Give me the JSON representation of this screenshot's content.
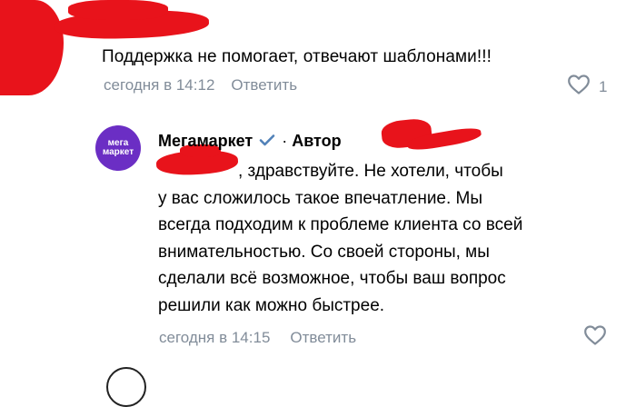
{
  "comment1": {
    "text": "Поддержка не помогает, отвечают шаблонами!!!",
    "time": "сегодня в 14:12",
    "reply_label": "Ответить",
    "like_count": "1"
  },
  "comment2": {
    "author": "Мегамаркет",
    "author_badge": "Автор",
    "avatar_text_1": "мега",
    "avatar_text_2": "маркет",
    "lines": [
      ", здравствуйте. Не хотели, чтобы",
      "у вас сложилось такое впечатление. Мы",
      "всегда подходим к проблеме клиента со всей",
      "внимательностью. Со своей стороны, мы",
      "сделали всё возможное, чтобы ваш вопрос",
      "решили как можно быстрее."
    ],
    "time": "сегодня в 14:15",
    "reply_label": "Ответить"
  },
  "colors": {
    "accent": "#5181b8",
    "muted": "#818c99",
    "redaction": "#e8131b",
    "avatar_bg": "#6b2ec4"
  },
  "icons": {
    "heart": "heart-outline-icon",
    "verified": "check-icon"
  }
}
